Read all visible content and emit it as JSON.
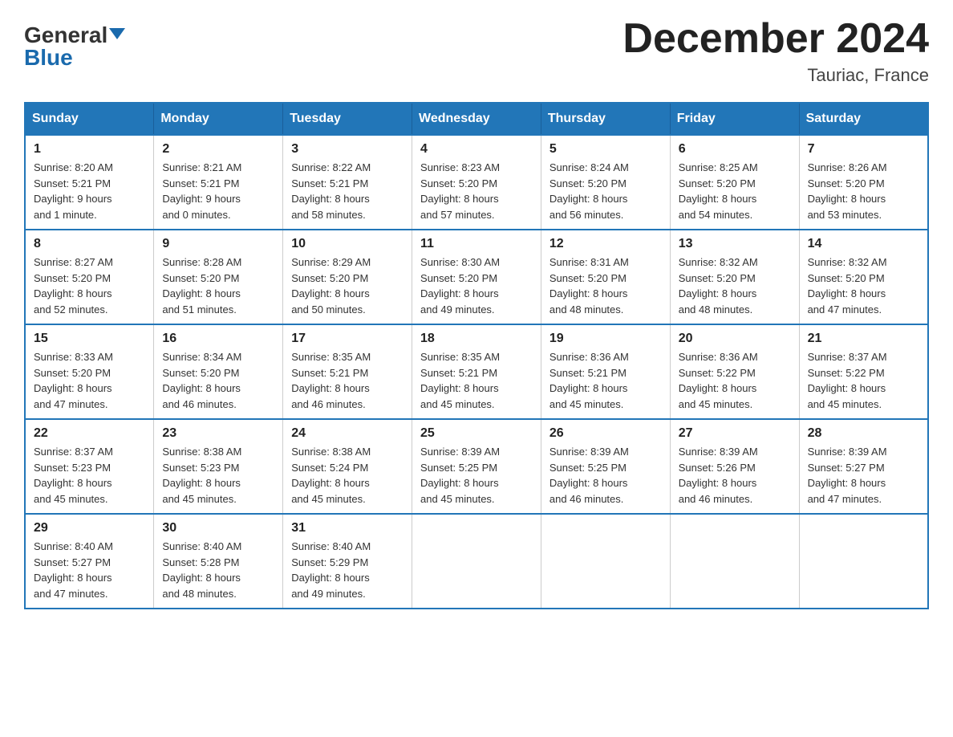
{
  "header": {
    "logo_general": "General",
    "logo_blue": "Blue",
    "month_title": "December 2024",
    "location": "Tauriac, France"
  },
  "days_of_week": [
    "Sunday",
    "Monday",
    "Tuesday",
    "Wednesday",
    "Thursday",
    "Friday",
    "Saturday"
  ],
  "weeks": [
    [
      {
        "num": "1",
        "sunrise": "8:20 AM",
        "sunset": "5:21 PM",
        "daylight": "9 hours and 1 minute."
      },
      {
        "num": "2",
        "sunrise": "8:21 AM",
        "sunset": "5:21 PM",
        "daylight": "9 hours and 0 minutes."
      },
      {
        "num": "3",
        "sunrise": "8:22 AM",
        "sunset": "5:21 PM",
        "daylight": "8 hours and 58 minutes."
      },
      {
        "num": "4",
        "sunrise": "8:23 AM",
        "sunset": "5:20 PM",
        "daylight": "8 hours and 57 minutes."
      },
      {
        "num": "5",
        "sunrise": "8:24 AM",
        "sunset": "5:20 PM",
        "daylight": "8 hours and 56 minutes."
      },
      {
        "num": "6",
        "sunrise": "8:25 AM",
        "sunset": "5:20 PM",
        "daylight": "8 hours and 54 minutes."
      },
      {
        "num": "7",
        "sunrise": "8:26 AM",
        "sunset": "5:20 PM",
        "daylight": "8 hours and 53 minutes."
      }
    ],
    [
      {
        "num": "8",
        "sunrise": "8:27 AM",
        "sunset": "5:20 PM",
        "daylight": "8 hours and 52 minutes."
      },
      {
        "num": "9",
        "sunrise": "8:28 AM",
        "sunset": "5:20 PM",
        "daylight": "8 hours and 51 minutes."
      },
      {
        "num": "10",
        "sunrise": "8:29 AM",
        "sunset": "5:20 PM",
        "daylight": "8 hours and 50 minutes."
      },
      {
        "num": "11",
        "sunrise": "8:30 AM",
        "sunset": "5:20 PM",
        "daylight": "8 hours and 49 minutes."
      },
      {
        "num": "12",
        "sunrise": "8:31 AM",
        "sunset": "5:20 PM",
        "daylight": "8 hours and 48 minutes."
      },
      {
        "num": "13",
        "sunrise": "8:32 AM",
        "sunset": "5:20 PM",
        "daylight": "8 hours and 48 minutes."
      },
      {
        "num": "14",
        "sunrise": "8:32 AM",
        "sunset": "5:20 PM",
        "daylight": "8 hours and 47 minutes."
      }
    ],
    [
      {
        "num": "15",
        "sunrise": "8:33 AM",
        "sunset": "5:20 PM",
        "daylight": "8 hours and 47 minutes."
      },
      {
        "num": "16",
        "sunrise": "8:34 AM",
        "sunset": "5:20 PM",
        "daylight": "8 hours and 46 minutes."
      },
      {
        "num": "17",
        "sunrise": "8:35 AM",
        "sunset": "5:21 PM",
        "daylight": "8 hours and 46 minutes."
      },
      {
        "num": "18",
        "sunrise": "8:35 AM",
        "sunset": "5:21 PM",
        "daylight": "8 hours and 45 minutes."
      },
      {
        "num": "19",
        "sunrise": "8:36 AM",
        "sunset": "5:21 PM",
        "daylight": "8 hours and 45 minutes."
      },
      {
        "num": "20",
        "sunrise": "8:36 AM",
        "sunset": "5:22 PM",
        "daylight": "8 hours and 45 minutes."
      },
      {
        "num": "21",
        "sunrise": "8:37 AM",
        "sunset": "5:22 PM",
        "daylight": "8 hours and 45 minutes."
      }
    ],
    [
      {
        "num": "22",
        "sunrise": "8:37 AM",
        "sunset": "5:23 PM",
        "daylight": "8 hours and 45 minutes."
      },
      {
        "num": "23",
        "sunrise": "8:38 AM",
        "sunset": "5:23 PM",
        "daylight": "8 hours and 45 minutes."
      },
      {
        "num": "24",
        "sunrise": "8:38 AM",
        "sunset": "5:24 PM",
        "daylight": "8 hours and 45 minutes."
      },
      {
        "num": "25",
        "sunrise": "8:39 AM",
        "sunset": "5:25 PM",
        "daylight": "8 hours and 45 minutes."
      },
      {
        "num": "26",
        "sunrise": "8:39 AM",
        "sunset": "5:25 PM",
        "daylight": "8 hours and 46 minutes."
      },
      {
        "num": "27",
        "sunrise": "8:39 AM",
        "sunset": "5:26 PM",
        "daylight": "8 hours and 46 minutes."
      },
      {
        "num": "28",
        "sunrise": "8:39 AM",
        "sunset": "5:27 PM",
        "daylight": "8 hours and 47 minutes."
      }
    ],
    [
      {
        "num": "29",
        "sunrise": "8:40 AM",
        "sunset": "5:27 PM",
        "daylight": "8 hours and 47 minutes."
      },
      {
        "num": "30",
        "sunrise": "8:40 AM",
        "sunset": "5:28 PM",
        "daylight": "8 hours and 48 minutes."
      },
      {
        "num": "31",
        "sunrise": "8:40 AM",
        "sunset": "5:29 PM",
        "daylight": "8 hours and 49 minutes."
      },
      null,
      null,
      null,
      null
    ]
  ],
  "labels": {
    "sunrise": "Sunrise:",
    "sunset": "Sunset:",
    "daylight": "Daylight:"
  }
}
